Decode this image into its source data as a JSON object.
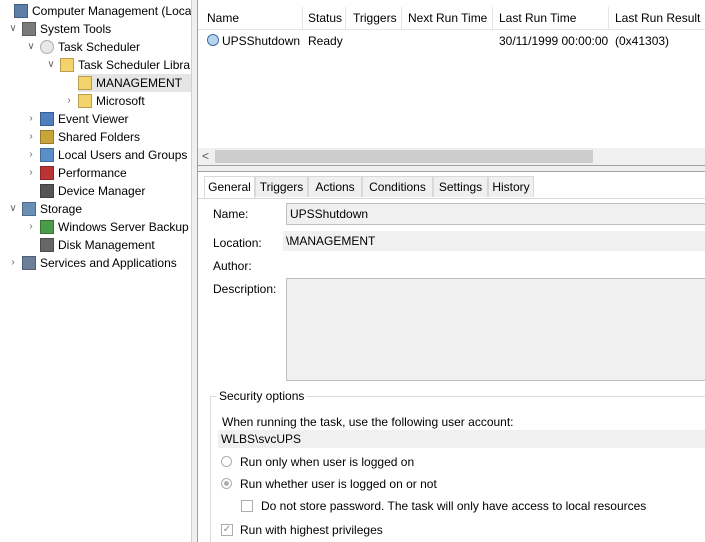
{
  "tree": {
    "items": [
      {
        "label": "Computer Management (Local",
        "icon": "computer-management-icon",
        "twisty": "",
        "level": 0
      },
      {
        "label": "System Tools",
        "icon": "system-tools-icon",
        "twisty": "v",
        "level": 1
      },
      {
        "label": "Task Scheduler",
        "icon": "clock-icon",
        "twisty": "v",
        "level": 2
      },
      {
        "label": "Task Scheduler Libra",
        "icon": "folder-clock-icon",
        "twisty": "v",
        "level": 3
      },
      {
        "label": "MANAGEMENT",
        "icon": "folder-icon",
        "twisty": "",
        "level": 4,
        "selected": true
      },
      {
        "label": "Microsoft",
        "icon": "folder-icon",
        "twisty": ">",
        "level": 4
      },
      {
        "label": "Event Viewer",
        "icon": "event-viewer-icon",
        "twisty": ">",
        "level": 2
      },
      {
        "label": "Shared Folders",
        "icon": "shared-folder-icon",
        "twisty": ">",
        "level": 2
      },
      {
        "label": "Local Users and Groups",
        "icon": "users-icon",
        "twisty": ">",
        "level": 2
      },
      {
        "label": "Performance",
        "icon": "performance-icon",
        "twisty": ">",
        "level": 2
      },
      {
        "label": "Device Manager",
        "icon": "device-manager-icon",
        "twisty": "",
        "level": 2
      },
      {
        "label": "Storage",
        "icon": "storage-icon",
        "twisty": "v",
        "level": 1
      },
      {
        "label": "Windows Server Backup",
        "icon": "backup-icon",
        "twisty": ">",
        "level": 2
      },
      {
        "label": "Disk Management",
        "icon": "disk-icon",
        "twisty": "",
        "level": 2
      },
      {
        "label": "Services and Applications",
        "icon": "services-icon",
        "twisty": ">",
        "level": 1
      }
    ]
  },
  "tasks": {
    "columns": [
      "Name",
      "Status",
      "Triggers",
      "Next Run Time",
      "Last Run Time",
      "Last Run Result"
    ],
    "rows": [
      {
        "name": "UPSShutdown",
        "status": "Ready",
        "triggers": "",
        "next_run": "",
        "last_run": "30/11/1999 00:00:00",
        "result": "(0x41303)"
      }
    ],
    "scroll_left_arrow": "<"
  },
  "props": {
    "tabs": [
      "General",
      "Triggers",
      "Actions",
      "Conditions",
      "Settings",
      "History"
    ],
    "active_tab": "General",
    "name_label": "Name:",
    "name_value": "UPSShutdown",
    "location_label": "Location:",
    "location_value": "\\MANAGEMENT",
    "author_label": "Author:",
    "author_value": "",
    "description_label": "Description:",
    "description_value": "",
    "security": {
      "title": "Security options",
      "account_prompt": "When running the task, use the following user account:",
      "account": "WLBS\\svcUPS",
      "radio_logged_on": "Run only when user is logged on",
      "radio_whether": "Run whether user is logged on or not",
      "radio_selected": "whether",
      "no_store_password": "Do not store password.  The task will only have access to local resources",
      "highest_privileges": "Run with highest privileges",
      "highest_checked": true
    }
  }
}
